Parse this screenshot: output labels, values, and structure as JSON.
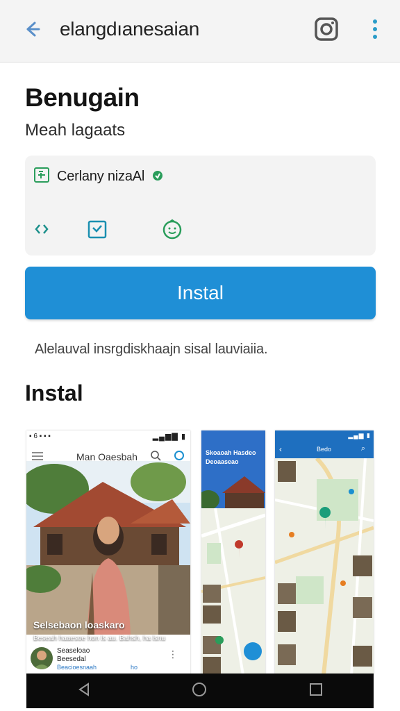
{
  "app_bar": {
    "title": "elangdıanesaian",
    "back_icon": "arrow-back-icon",
    "camera_icon": "instagram-camera-icon",
    "more_icon": "more-vertical-icon"
  },
  "app": {
    "name": "Benugain",
    "subtitle": "Meah lagaats"
  },
  "info_card": {
    "badge_text": "Cerlany nizaAl",
    "icons": [
      "code-brackets-icon",
      "calendar-check-icon",
      "smiley-icon"
    ]
  },
  "install_button": {
    "label": "Instal"
  },
  "description": "Alelauval insrgdiskhaajn sisal lauviaiia.",
  "screenshots_section": {
    "title": "Instal",
    "shot1": {
      "toolbar_title": "Man Oaesbah",
      "caption_title": "Selsebaon loaskaro",
      "caption_text": "Beseah haaesoe hon ls au. Bahsh, ha lsnu ohsoe hsdg",
      "card_name": "Seaseloao\nBeesedal",
      "card_link": "Beacioesnaah",
      "card_link2": "ho"
    },
    "shot2": {
      "top_text": "Skoaoah Hasdeo\nDeoaaseao"
    },
    "shot3": {
      "title": "Bedo"
    }
  },
  "colors": {
    "accent": "#1f8fd6",
    "green": "#2a9d5b",
    "teal": "#1a8fb0"
  }
}
